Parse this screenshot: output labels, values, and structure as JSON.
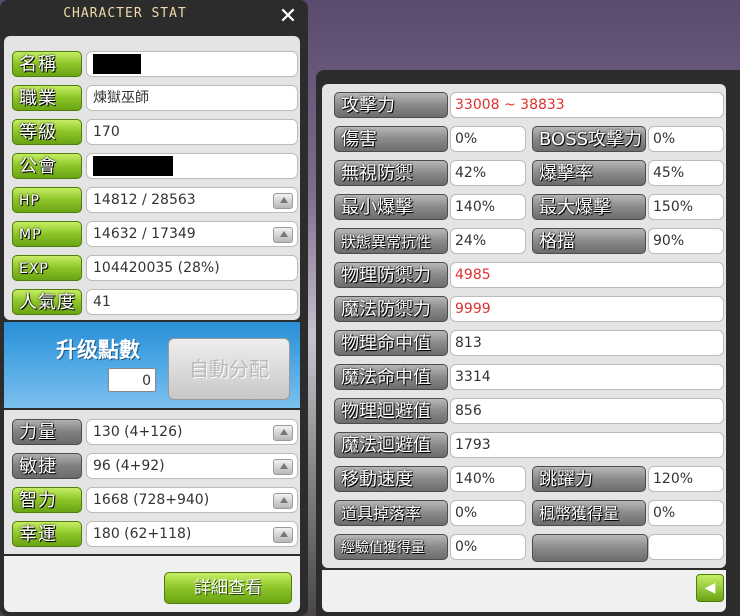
{
  "window": {
    "title": "CHARACTER STAT",
    "close_glyph": "✕"
  },
  "left": {
    "rows": [
      {
        "label": "名稱",
        "value": ""
      },
      {
        "label": "職業",
        "value": "煉獄巫師"
      },
      {
        "label": "等級",
        "value": "170"
      },
      {
        "label": "公會",
        "value": ""
      },
      {
        "label": "HP",
        "value": "14812 / 28563"
      },
      {
        "label": "MP",
        "value": "14632 / 17349"
      },
      {
        "label": "EXP",
        "value": "104420035 (28%)"
      },
      {
        "label": "人氣度",
        "value": "41"
      }
    ],
    "ap": {
      "label": "升级點數",
      "value": "0",
      "auto_button": "自動分配"
    },
    "stats": [
      {
        "label": "力量",
        "value": "130 (4+126)"
      },
      {
        "label": "敏捷",
        "value": "96 (4+92)"
      },
      {
        "label": "智力",
        "value": "1668 (728+940)"
      },
      {
        "label": "幸運",
        "value": "180 (62+118)"
      }
    ],
    "detail_button": "詳細查看"
  },
  "right": {
    "attack": {
      "label": "攻擊力",
      "value": "33008 ~ 38833"
    },
    "damage": {
      "label": "傷害",
      "value": "0%"
    },
    "boss": {
      "label": "BOSS攻擊力",
      "value": "0%"
    },
    "ignore_def": {
      "label": "無視防禦",
      "value": "42%"
    },
    "crit_rate": {
      "label": "爆擊率",
      "value": "45%"
    },
    "min_crit": {
      "label": "最小爆擊",
      "value": "140%"
    },
    "max_crit": {
      "label": "最大爆擊",
      "value": "150%"
    },
    "status_res": {
      "label": "狀態異常抗性",
      "value": "24%"
    },
    "block": {
      "label": "格擋",
      "value": "90%"
    },
    "phys_def": {
      "label": "物理防禦力",
      "value": "4985"
    },
    "magic_def": {
      "label": "魔法防禦力",
      "value": "9999"
    },
    "phys_acc": {
      "label": "物理命中值",
      "value": "813"
    },
    "magic_acc": {
      "label": "魔法命中值",
      "value": "3314"
    },
    "phys_eva": {
      "label": "物理迴避值",
      "value": "856"
    },
    "magic_eva": {
      "label": "魔法迴避值",
      "value": "1793"
    },
    "speed": {
      "label": "移動速度",
      "value": "140%"
    },
    "jump": {
      "label": "跳躍力",
      "value": "120%"
    },
    "item_drop": {
      "label": "道具掉落率",
      "value": "0%"
    },
    "meso": {
      "label": "楓幣獲得量",
      "value": "0%"
    },
    "exp_gain": {
      "label": "經驗值獲得量",
      "value": "0%"
    }
  }
}
